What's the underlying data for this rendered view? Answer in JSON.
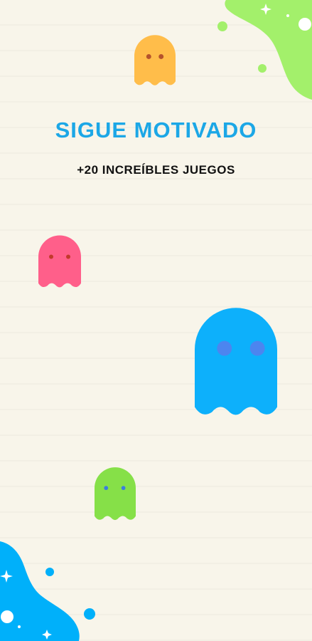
{
  "screen": {
    "title": "SIGUE MOTIVADO",
    "subtitle": "+20 INCREÍBLES JUEGOS"
  },
  "colors": {
    "background": "#f8f5ea",
    "title": "#1ca7e6",
    "subtitle": "#111111",
    "green_blob": "#a3f06b",
    "blue_blob": "#00b0fa"
  },
  "ghosts": [
    {
      "name": "orange-ghost-icon",
      "body_color": "#ffbd4a",
      "eye_color": "#b5532c"
    },
    {
      "name": "pink-ghost-icon",
      "body_color": "#ff5f8a",
      "eye_color": "#c23a2b"
    },
    {
      "name": "blue-ghost-icon",
      "body_color": "#0db0fb",
      "eye_color": "#4c85ef"
    },
    {
      "name": "green-ghost-icon",
      "body_color": "#86e048",
      "eye_color": "#3a7de0"
    }
  ]
}
